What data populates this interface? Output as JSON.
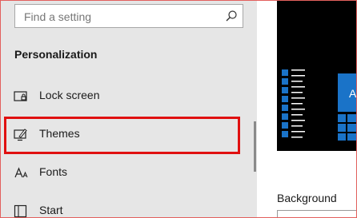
{
  "search": {
    "placeholder": "Find a setting",
    "icon": "search-icon"
  },
  "sidebar": {
    "section_title": "Personalization",
    "items": [
      {
        "label": "Lock screen",
        "icon": "lock-screen-icon"
      },
      {
        "label": "Themes",
        "icon": "themes-icon",
        "highlighted": true
      },
      {
        "label": "Fonts",
        "icon": "fonts-icon"
      },
      {
        "label": "Start",
        "icon": "start-icon"
      }
    ]
  },
  "main": {
    "preview_tile_letter": "A",
    "background_label": "Background"
  },
  "colors": {
    "sidebar_bg": "#e6e6e6",
    "accent": "#1a73c8",
    "highlight": "#e01010"
  }
}
